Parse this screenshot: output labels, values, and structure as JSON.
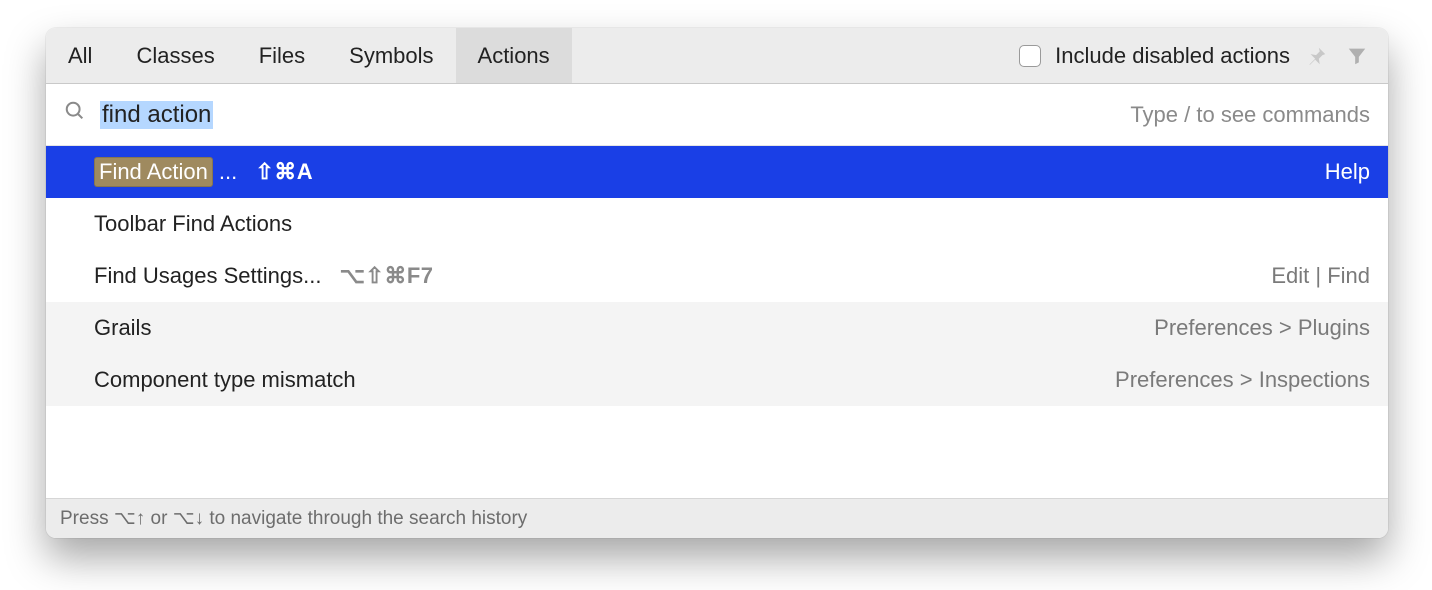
{
  "tabs": {
    "0": "All",
    "1": "Classes",
    "2": "Files",
    "3": "Symbols",
    "4": "Actions"
  },
  "include_disabled_label": "Include disabled actions",
  "search": {
    "query": "find action",
    "hint": "Type / to see commands"
  },
  "results": {
    "0": {
      "label_highlight": "Find Action",
      "label_suffix": "...",
      "shortcut": "⇧⌘A",
      "location": "Help"
    },
    "1": {
      "label": "Toolbar Find Actions",
      "location": ""
    },
    "2": {
      "label": "Find Usages Settings...",
      "shortcut": "⌥⇧⌘F7",
      "location": "Edit | Find"
    },
    "3": {
      "label": "Grails",
      "location": "Preferences > Plugins"
    },
    "4": {
      "label": "Component type mismatch",
      "location": "Preferences > Inspections"
    }
  },
  "footer": "Press ⌥↑ or ⌥↓ to navigate through the search history"
}
